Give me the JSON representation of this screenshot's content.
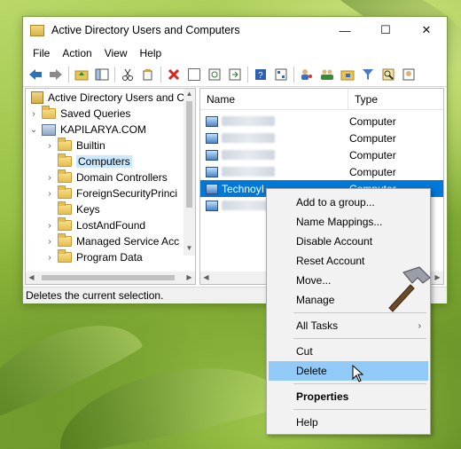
{
  "window": {
    "title": "Active Directory Users and Computers",
    "controls": {
      "minimize": "—",
      "maximize": "☐",
      "close": "✕"
    }
  },
  "menu": [
    "File",
    "Action",
    "View",
    "Help"
  ],
  "toolbar_icons": [
    "back-icon",
    "forward-icon",
    "up-folder-icon",
    "show-console-tree-icon",
    "cut-icon",
    "copy-icon",
    "delete-icon",
    "properties-icon",
    "refresh-icon",
    "export-list-icon",
    "help-icon",
    "console-tree-icon",
    "users-icon",
    "groups-icon",
    "ou-icon",
    "filter-icon",
    "find-icon",
    "add-to-group-icon"
  ],
  "tree": {
    "root": "Active Directory Users and Co",
    "items": [
      {
        "label": "Saved Queries",
        "indent": 1,
        "expander": "›"
      },
      {
        "label": "KAPILARYA.COM",
        "indent": 1,
        "expander": "⌄"
      },
      {
        "label": "Builtin",
        "indent": 2,
        "expander": "›"
      },
      {
        "label": "Computers",
        "indent": 2,
        "expander": "",
        "selected": true
      },
      {
        "label": "Domain Controllers",
        "indent": 2,
        "expander": "›"
      },
      {
        "label": "ForeignSecurityPrinci",
        "indent": 2,
        "expander": "›"
      },
      {
        "label": "Keys",
        "indent": 2,
        "expander": ""
      },
      {
        "label": "LostAndFound",
        "indent": 2,
        "expander": "›"
      },
      {
        "label": "Managed Service Acc",
        "indent": 2,
        "expander": "›"
      },
      {
        "label": "Program Data",
        "indent": 2,
        "expander": "›"
      }
    ]
  },
  "list": {
    "columns": {
      "name": "Name",
      "type": "Type"
    },
    "rows": [
      {
        "name": "",
        "type": "Computer",
        "blurred": true
      },
      {
        "name": "",
        "type": "Computer",
        "blurred": true
      },
      {
        "name": "",
        "type": "Computer",
        "blurred": true
      },
      {
        "name": "",
        "type": "Computer",
        "blurred": true
      },
      {
        "name": "TechnoyI",
        "type": "Computer",
        "selected": true
      },
      {
        "name": "",
        "type": "",
        "blurred": true
      }
    ]
  },
  "status": "Deletes the current selection.",
  "context_menu": [
    {
      "label": "Add to a group..."
    },
    {
      "label": "Name Mappings..."
    },
    {
      "label": "Disable Account"
    },
    {
      "label": "Reset Account"
    },
    {
      "label": "Move..."
    },
    {
      "label": "Manage"
    },
    {
      "separator": true
    },
    {
      "label": "All Tasks",
      "submenu": true
    },
    {
      "separator": true
    },
    {
      "label": "Cut"
    },
    {
      "label": "Delete",
      "hover": true
    },
    {
      "separator": true
    },
    {
      "label": "Properties",
      "bold": true
    },
    {
      "separator": true
    },
    {
      "label": "Help"
    }
  ],
  "colors": {
    "selection": "#0078d7",
    "menu_hover": "#91c9f7",
    "tree_selection": "#cce8ff"
  }
}
